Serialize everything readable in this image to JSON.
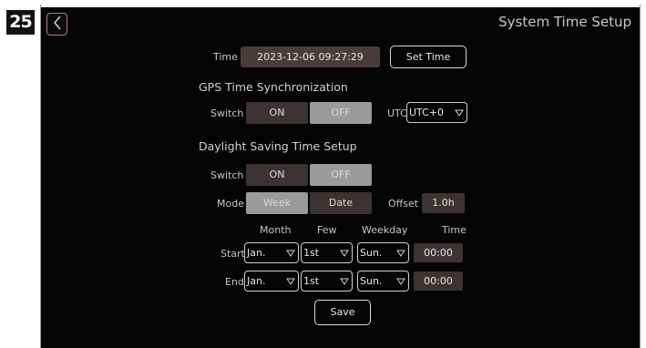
{
  "step_number": "25",
  "screen": {
    "title": "System Time Setup",
    "time": {
      "label": "Time",
      "value": "2023-12-06 09:27:29",
      "set_button": "Set Time"
    },
    "gps": {
      "heading": "GPS Time Synchronization",
      "switch_label": "Switch",
      "on": "ON",
      "off": "OFF",
      "utc_label": "UTC",
      "utc_value": "UTC+0"
    },
    "dst": {
      "heading": "Daylight Saving Time Setup",
      "switch_label": "Switch",
      "on": "ON",
      "off": "OFF",
      "mode_label": "Mode",
      "mode_week": "Week",
      "mode_date": "Date",
      "offset_label": "Offset",
      "offset_value": "1.0h",
      "columns": {
        "month": "Month",
        "few": "Few",
        "weekday": "Weekday",
        "time": "Time"
      },
      "start": {
        "label": "Start",
        "month": "Jan.",
        "few": "1st",
        "weekday": "Sun.",
        "time": "00:00"
      },
      "end": {
        "label": "End",
        "month": "Jan.",
        "few": "1st",
        "weekday": "Sun.",
        "time": "00:00"
      }
    },
    "save_button": "Save"
  },
  "colors": {
    "screen_bg": "#050505",
    "selected_bg": "#3d3333",
    "unselected_bg": "#9a9a9a",
    "back_button_border": "#b77b7b"
  }
}
